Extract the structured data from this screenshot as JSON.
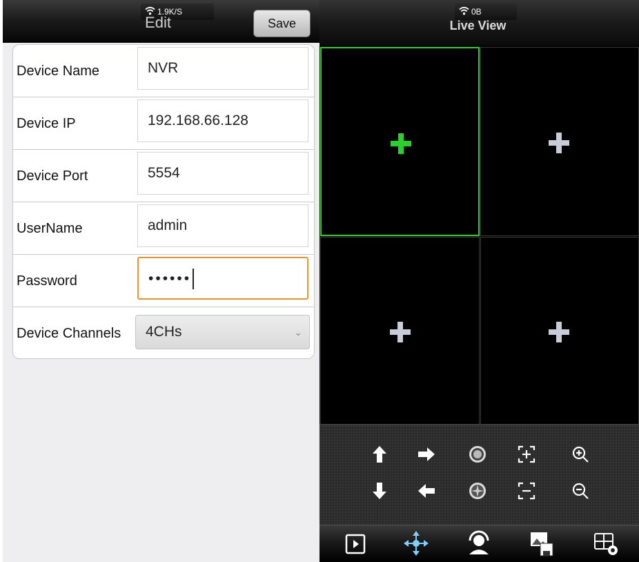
{
  "left": {
    "status": {
      "speed": "1.9K/S",
      "wifi_icon": "wifi-icon"
    },
    "title": "Edit",
    "save_label": "Save",
    "fields": [
      {
        "label": "Device Name",
        "value": "NVR"
      },
      {
        "label": "Device IP",
        "value": "192.168.66.128"
      },
      {
        "label": "Device Port",
        "value": "5554"
      },
      {
        "label": "UserName",
        "value": "admin"
      },
      {
        "label": "Password",
        "value": "••••••"
      }
    ],
    "channels": {
      "label": "Device Channels",
      "value": "4CHs"
    }
  },
  "right": {
    "status": {
      "speed": "0B",
      "wifi_icon": "wifi-icon"
    },
    "title": "Live View",
    "grid": {
      "active_index": 0,
      "active_color": "#2ad12a",
      "idle_color": "#c8ccd8"
    },
    "controls": [
      "arrow-up-icon",
      "arrow-right-icon",
      "iris-open-icon",
      "focus-plus-icon",
      "zoom-in-icon",
      "arrow-down-icon",
      "arrow-left-icon",
      "iris-close-icon",
      "focus-minus-icon",
      "zoom-out-icon"
    ],
    "tabs": [
      "playback-icon",
      "ptz-icon",
      "support-icon",
      "snapshot-icon",
      "settings-icon"
    ]
  }
}
